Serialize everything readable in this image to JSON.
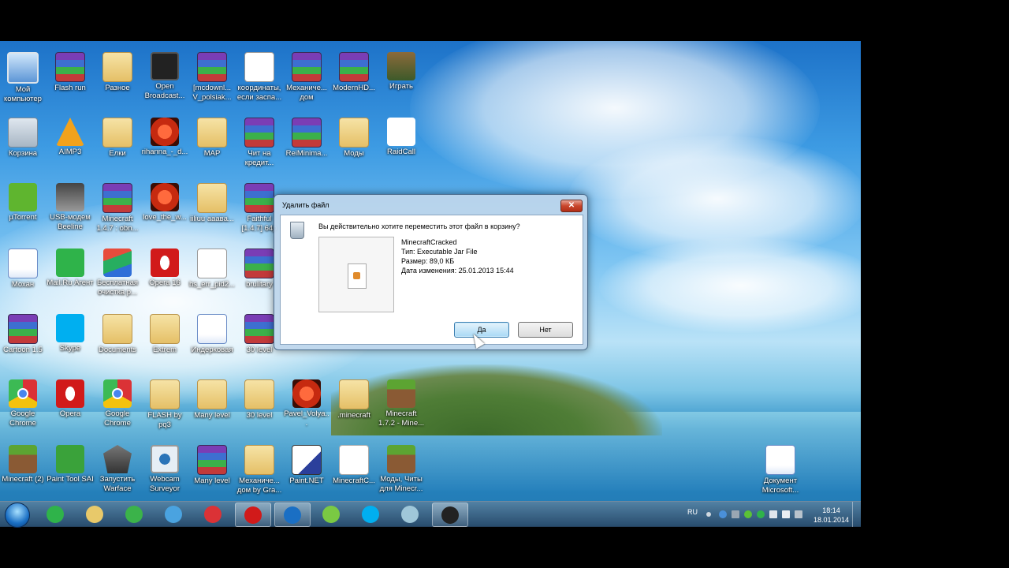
{
  "desktop": {
    "icons": [
      {
        "label": "Мой компьютер",
        "icon": "computer-icon",
        "cls": "comp"
      },
      {
        "label": "Flash run",
        "icon": "winrar-icon",
        "cls": "rar"
      },
      {
        "label": "Разное",
        "icon": "folder-icon",
        "cls": "folder"
      },
      {
        "label": "Open Broadcast...",
        "icon": "obs-icon",
        "cls": "obs"
      },
      {
        "label": "[mcdownl... V_polsiak...",
        "icon": "winrar-icon",
        "cls": "rar"
      },
      {
        "label": "координаты, если заспа...",
        "icon": "text-file-icon",
        "cls": "doc"
      },
      {
        "label": "Механиче... дом",
        "icon": "winrar-icon",
        "cls": "rar"
      },
      {
        "label": "ModernHD...",
        "icon": "winrar-icon",
        "cls": "rar"
      },
      {
        "label": "Играть",
        "icon": "game-icon",
        "cls": "game"
      },
      {
        "label": "Корзина",
        "icon": "recycle-bin-icon",
        "cls": "recycle"
      },
      {
        "label": "AIMP3",
        "icon": "aimp-icon",
        "cls": "aimp"
      },
      {
        "label": "Елки",
        "icon": "folder-icon",
        "cls": "folder"
      },
      {
        "label": "rihanna_-_d...",
        "icon": "mp3-icon",
        "cls": "mp3"
      },
      {
        "label": "MAP",
        "icon": "folder-icon",
        "cls": "folder"
      },
      {
        "label": "Чит на кредит...",
        "icon": "winrar-icon",
        "cls": "rar"
      },
      {
        "label": "ReiMinima...",
        "icon": "winrar-icon",
        "cls": "rar"
      },
      {
        "label": "Моды",
        "icon": "folder-icon",
        "cls": "folder"
      },
      {
        "label": "RaidCall",
        "icon": "raidcall-icon",
        "cls": "raid"
      },
      {
        "label": "µTorrent",
        "icon": "utorrent-icon",
        "cls": "utor"
      },
      {
        "label": "USB-модем Beeline",
        "icon": "usb-modem-icon",
        "cls": "usb"
      },
      {
        "label": "Minecraft 1.4.7 : obn...",
        "icon": "winrar-icon",
        "cls": "rar"
      },
      {
        "label": "love_the_w...",
        "icon": "mp3-icon",
        "cls": "mp3"
      },
      {
        "label": "iiliuu ааава...",
        "icon": "folder-icon",
        "cls": "folder"
      },
      {
        "label": "Faithful [1.4.7] 64p",
        "icon": "winrar-icon",
        "cls": "rar"
      },
      {
        "label": "Мохан",
        "icon": "word-doc-icon",
        "cls": "wdoc"
      },
      {
        "label": "Mail.Ru Агент",
        "icon": "mail-agent-icon",
        "cls": "mail"
      },
      {
        "label": "Бесплатная очистка р...",
        "icon": "cleaner-icon",
        "cls": "flag"
      },
      {
        "label": "Opera 16",
        "icon": "opera-icon",
        "cls": "opera"
      },
      {
        "label": "hs_err_pid2...",
        "icon": "text-file-icon",
        "cls": "doc"
      },
      {
        "label": "brulitary",
        "icon": "winrar-icon",
        "cls": "rar"
      },
      {
        "label": "Cartoon 1.5",
        "icon": "winrar-icon",
        "cls": "rar"
      },
      {
        "label": "Skype",
        "icon": "skype-icon",
        "cls": "skype"
      },
      {
        "label": "Documents",
        "icon": "folder-icon",
        "cls": "folder"
      },
      {
        "label": "Extrem",
        "icon": "folder-icon",
        "cls": "folder"
      },
      {
        "label": "Индерковая",
        "icon": "word-doc-icon",
        "cls": "wdoc"
      },
      {
        "label": "30 level",
        "icon": "winrar-icon",
        "cls": "rar"
      },
      {
        "label": "Google Chrome",
        "icon": "chrome-icon",
        "cls": "chrome"
      },
      {
        "label": "Opera",
        "icon": "opera-icon",
        "cls": "opera"
      },
      {
        "label": "Google Chrome",
        "icon": "chrome-icon",
        "cls": "chrome"
      },
      {
        "label": "FLASH by pq3",
        "icon": "folder-icon",
        "cls": "folder"
      },
      {
        "label": "Many level",
        "icon": "folder-icon",
        "cls": "folder"
      },
      {
        "label": "30 level",
        "icon": "folder-icon",
        "cls": "folder"
      },
      {
        "label": "Pavel_Volya...",
        "icon": "mp3-icon",
        "cls": "mp3"
      },
      {
        "label": ".minecraft",
        "icon": "folder-icon",
        "cls": "folder"
      },
      {
        "label": "Minecraft 1.7.2 - Mine...",
        "icon": "minecraft-icon",
        "cls": "mc"
      },
      {
        "label": "Minecraft (2)",
        "icon": "minecraft-icon",
        "cls": "mc"
      },
      {
        "label": "Paint Tool SAI",
        "icon": "paint-tool-icon",
        "cls": "green"
      },
      {
        "label": "Запустить Warface",
        "icon": "warface-icon",
        "cls": "tank"
      },
      {
        "label": "Webcam Surveyor",
        "icon": "webcam-icon",
        "cls": "webcam"
      },
      {
        "label": "Many level",
        "icon": "winrar-icon",
        "cls": "rar"
      },
      {
        "label": "Механиче... дом by Gra...",
        "icon": "folder-icon",
        "cls": "folder"
      },
      {
        "label": "Paint.NET",
        "icon": "paint-net-icon",
        "cls": "paint"
      },
      {
        "label": "MinecraftC...",
        "icon": "jar-file-icon",
        "cls": "jar"
      },
      {
        "label": "Моды, Читы для Minecr...",
        "icon": "minecraft-icon",
        "cls": "mc"
      },
      {
        "label": "Документ Microsoft...",
        "icon": "word-doc-icon",
        "cls": "wdoc"
      }
    ]
  },
  "dialog": {
    "title": "Удалить файл",
    "close_label": "✕",
    "question": "Вы действительно хотите переместить этот файл в корзину?",
    "file_name": "MinecraftCracked",
    "file_type": "Тип: Executable Jar File",
    "file_size": "Размер: 89,0 КБ",
    "file_date": "Дата изменения: 25.01.2013 15:44",
    "yes_label": "Да",
    "no_label": "Нет"
  },
  "taskbar": {
    "items": [
      "mail-agent-icon",
      "explorer-icon",
      "aimp-icon",
      "skype-update-icon",
      "chrome-icon",
      "opera-icon",
      "utorrent-icon",
      "icq-icon",
      "skype-icon",
      "virtualbox-icon",
      "obs-icon"
    ],
    "language": "RU",
    "time": "18:14",
    "date": "18.01.2014"
  }
}
